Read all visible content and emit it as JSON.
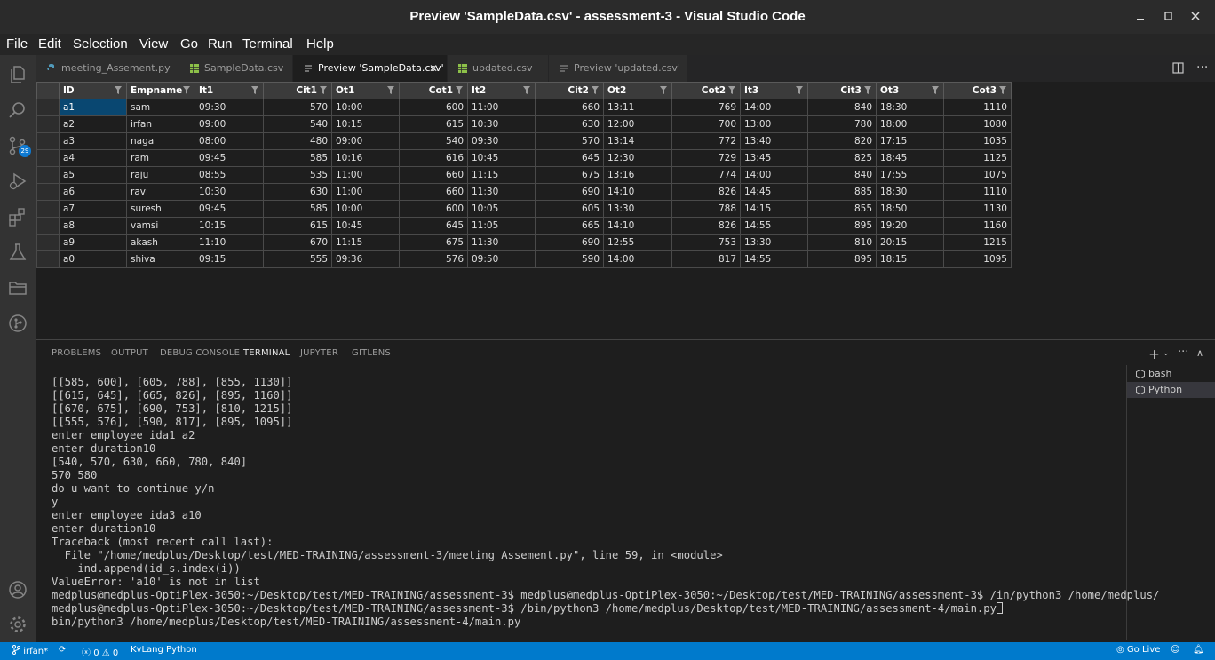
{
  "window": {
    "title": "Preview 'SampleData.csv' - assessment-3 - Visual Studio Code"
  },
  "menu": [
    "File",
    "Edit",
    "Selection",
    "View",
    "Go",
    "Run",
    "Terminal",
    "Help"
  ],
  "activity": {
    "scm_badge": "29"
  },
  "tabs": [
    {
      "label": "meeting_Assement.py",
      "icon": "python-icon",
      "active": false
    },
    {
      "label": "SampleData.csv",
      "icon": "csv-icon",
      "active": false
    },
    {
      "label": "Preview 'SampleData.csv'",
      "icon": "preview-icon",
      "active": true
    },
    {
      "label": "updated.csv",
      "icon": "csv-icon",
      "active": false
    },
    {
      "label": "Preview 'updated.csv'",
      "icon": "preview-icon",
      "active": false
    }
  ],
  "csv": {
    "headers": [
      "ID",
      "Empname",
      "It1",
      "Cit1",
      "Ot1",
      "Cot1",
      "It2",
      "Cit2",
      "Ot2",
      "Cot2",
      "It3",
      "Cit3",
      "Ot3",
      "Cot3"
    ],
    "rows": [
      [
        "a1",
        "sam",
        "09:30",
        "570",
        "10:00",
        "600",
        "11:00",
        "660",
        "13:11",
        "769",
        "14:00",
        "840",
        "18:30",
        "1110"
      ],
      [
        "a2",
        "irfan",
        "09:00",
        "540",
        "10:15",
        "615",
        "10:30",
        "630",
        "12:00",
        "700",
        "13:00",
        "780",
        "18:00",
        "1080"
      ],
      [
        "a3",
        "naga",
        "08:00",
        "480",
        "09:00",
        "540",
        "09:30",
        "570",
        "13:14",
        "772",
        "13:40",
        "820",
        "17:15",
        "1035"
      ],
      [
        "a4",
        "ram",
        "09:45",
        "585",
        "10:16",
        "616",
        "10:45",
        "645",
        "12:30",
        "729",
        "13:45",
        "825",
        "18:45",
        "1125"
      ],
      [
        "a5",
        "raju",
        "08:55",
        "535",
        "11:00",
        "660",
        "11:15",
        "675",
        "13:16",
        "774",
        "14:00",
        "840",
        "17:55",
        "1075"
      ],
      [
        "a6",
        "ravi",
        "10:30",
        "630",
        "11:00",
        "660",
        "11:30",
        "690",
        "14:10",
        "826",
        "14:45",
        "885",
        "18:30",
        "1110"
      ],
      [
        "a7",
        "suresh",
        "09:45",
        "585",
        "10:00",
        "600",
        "10:05",
        "605",
        "13:30",
        "788",
        "14:15",
        "855",
        "18:50",
        "1130"
      ],
      [
        "a8",
        "vamsi",
        "10:15",
        "615",
        "10:45",
        "645",
        "11:05",
        "665",
        "14:10",
        "826",
        "14:55",
        "895",
        "19:20",
        "1160"
      ],
      [
        "a9",
        "akash",
        "11:10",
        "670",
        "11:15",
        "675",
        "11:30",
        "690",
        "12:55",
        "753",
        "13:30",
        "810",
        "20:15",
        "1215"
      ],
      [
        "a0",
        "shiva",
        "09:15",
        "555",
        "09:36",
        "576",
        "09:50",
        "590",
        "14:00",
        "817",
        "14:55",
        "895",
        "18:15",
        "1095"
      ]
    ]
  },
  "panel": {
    "tabs": [
      "PROBLEMS",
      "OUTPUT",
      "DEBUG CONSOLE",
      "TERMINAL",
      "JUPYTER",
      "GITLENS"
    ],
    "active_tab": "TERMINAL",
    "terminal_lines": [
      "[[585, 600], [605, 788], [855, 1130]]",
      "[[615, 645], [665, 826], [895, 1160]]",
      "[[670, 675], [690, 753], [810, 1215]]",
      "[[555, 576], [590, 817], [895, 1095]]",
      "enter employee ida1 a2",
      "enter duration10",
      "[540, 570, 630, 660, 780, 840]",
      "570 580",
      "do u want to continue y/n",
      "y",
      "enter employee ida3 a10",
      "enter duration10",
      "Traceback (most recent call last):",
      "  File \"/home/medplus/Desktop/test/MED-TRAINING/assessment-3/meeting_Assement.py\", line 59, in <module>",
      "    ind.append(id_s.index(i))",
      "ValueError: 'a10' is not in list",
      "medplus@medplus-OptiPlex-3050:~/Desktop/test/MED-TRAINING/assessment-3$ medplus@medplus-OptiPlex-3050:~/Desktop/test/MED-TRAINING/assessment-3$ /in/python3 /home/medplus/",
      "medplus@medplus-OptiPlex-3050:~/Desktop/test/MED-TRAINING/assessment-3$ /bin/python3 /home/medplus/Desktop/test/MED-TRAINING/assessment-4/main.py",
      "bin/python3 /home/medplus/Desktop/test/MED-TRAINING/assessment-4/main.py"
    ],
    "terminals": [
      {
        "label": "bash",
        "active": false
      },
      {
        "label": "Python",
        "active": true
      }
    ]
  },
  "status": {
    "branch": "irfan*",
    "errors": "0",
    "warnings": "0",
    "kvlang": "KvLang Python",
    "golive": "Go Live"
  },
  "colors": {
    "statusbar": "#007acc",
    "selected_cell": "#094771",
    "badge": "#0e7ad3"
  }
}
